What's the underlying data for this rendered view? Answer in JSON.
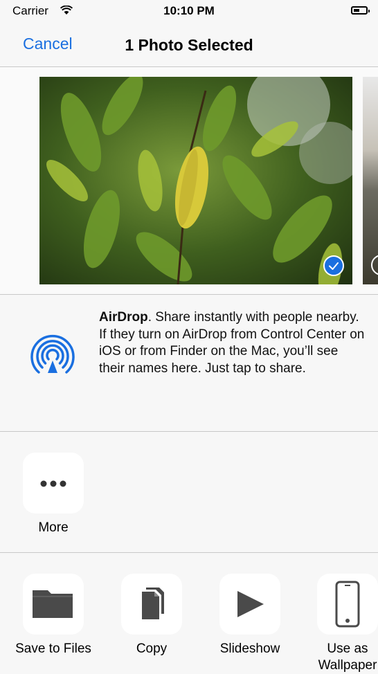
{
  "status_bar": {
    "carrier": "Carrier",
    "time": "10:10 PM"
  },
  "nav": {
    "cancel_label": "Cancel",
    "title": "1 Photo Selected"
  },
  "airdrop": {
    "title": "AirDrop",
    "description": ". Share instantly with people nearby. If they turn on AirDrop from Control Center on iOS or from Finder on the Mac, you’ll see their names here. Just tap to share."
  },
  "share_row": [
    {
      "label": "More",
      "icon": "more-icon"
    }
  ],
  "actions": [
    {
      "label": "Save to Files",
      "icon": "folder-icon"
    },
    {
      "label": "Copy",
      "icon": "copy-icon"
    },
    {
      "label": "Slideshow",
      "icon": "play-icon"
    },
    {
      "label": "Use as Wallpaper",
      "icon": "phone-icon"
    }
  ],
  "colors": {
    "accent": "#1a6fe0",
    "background": "#f7f7f7",
    "icon_gray": "#4a4a4a"
  }
}
